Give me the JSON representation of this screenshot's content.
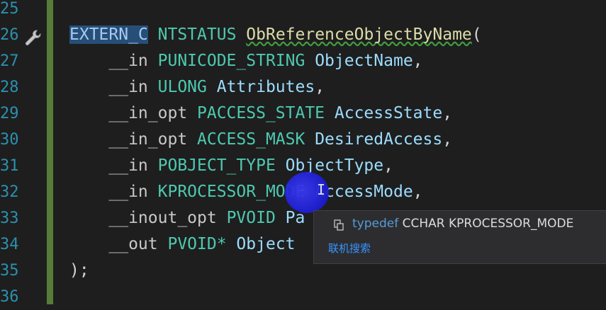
{
  "editor": {
    "lines": [
      {
        "num": "25",
        "parts": []
      },
      {
        "num": "26",
        "parts": [
          {
            "cls": "sel",
            "text": "EXTERN_C"
          },
          {
            "cls": "punct",
            "text": " "
          },
          {
            "cls": "type",
            "text": "NTSTATUS"
          },
          {
            "cls": "punct",
            "text": " "
          },
          {
            "cls": "fn",
            "text": "ObReferenceObjectByName"
          },
          {
            "cls": "punct",
            "text": "("
          }
        ]
      },
      {
        "num": "27",
        "parts": [
          {
            "cls": "anno",
            "text": "    __in "
          },
          {
            "cls": "type",
            "text": "PUNICODE_STRING"
          },
          {
            "cls": "param",
            "text": " ObjectName"
          },
          {
            "cls": "punct",
            "text": ","
          }
        ]
      },
      {
        "num": "28",
        "parts": [
          {
            "cls": "anno",
            "text": "    __in "
          },
          {
            "cls": "type",
            "text": "ULONG"
          },
          {
            "cls": "param",
            "text": " Attributes"
          },
          {
            "cls": "punct",
            "text": ","
          }
        ]
      },
      {
        "num": "29",
        "parts": [
          {
            "cls": "anno",
            "text": "    __in_opt "
          },
          {
            "cls": "type",
            "text": "PACCESS_STATE"
          },
          {
            "cls": "param",
            "text": " AccessState"
          },
          {
            "cls": "punct",
            "text": ","
          }
        ]
      },
      {
        "num": "30",
        "parts": [
          {
            "cls": "anno",
            "text": "    __in_opt "
          },
          {
            "cls": "type",
            "text": "ACCESS_MASK"
          },
          {
            "cls": "param",
            "text": " DesiredAccess"
          },
          {
            "cls": "punct",
            "text": ","
          }
        ]
      },
      {
        "num": "31",
        "parts": [
          {
            "cls": "anno",
            "text": "    __in "
          },
          {
            "cls": "type",
            "text": "POBJECT_TYPE"
          },
          {
            "cls": "param",
            "text": " ObjectType"
          },
          {
            "cls": "punct",
            "text": ","
          }
        ]
      },
      {
        "num": "32",
        "parts": [
          {
            "cls": "anno",
            "text": "    __in "
          },
          {
            "cls": "type",
            "text": "KPROCESSOR_MODE"
          },
          {
            "cls": "param",
            "text": " AccessMode"
          },
          {
            "cls": "punct",
            "text": ","
          }
        ]
      },
      {
        "num": "33",
        "parts": [
          {
            "cls": "anno",
            "text": "    __inout_opt "
          },
          {
            "cls": "type",
            "text": "PVOID"
          },
          {
            "cls": "param",
            "text": " Pa"
          }
        ]
      },
      {
        "num": "34",
        "parts": [
          {
            "cls": "anno",
            "text": "    __out "
          },
          {
            "cls": "type",
            "text": "PVOID*"
          },
          {
            "cls": "param",
            "text": " Object"
          }
        ]
      },
      {
        "num": "35",
        "parts": [
          {
            "cls": "punct",
            "text": ");"
          }
        ]
      },
      {
        "num": "36",
        "parts": []
      }
    ]
  },
  "tooltip": {
    "keyword": "typedef",
    "definition": "CCHAR KPROCESSOR_MODE",
    "search_link": "联机搜索"
  },
  "colors": {
    "background": "#1e1e1e",
    "change_bar": "#577c37",
    "line_number": "#2b91af",
    "type": "#4ec9b0",
    "selection": "#264f78"
  },
  "icons": {
    "breakpoint_hint": "wrench-icon",
    "tooltip": "typedef-icon"
  }
}
